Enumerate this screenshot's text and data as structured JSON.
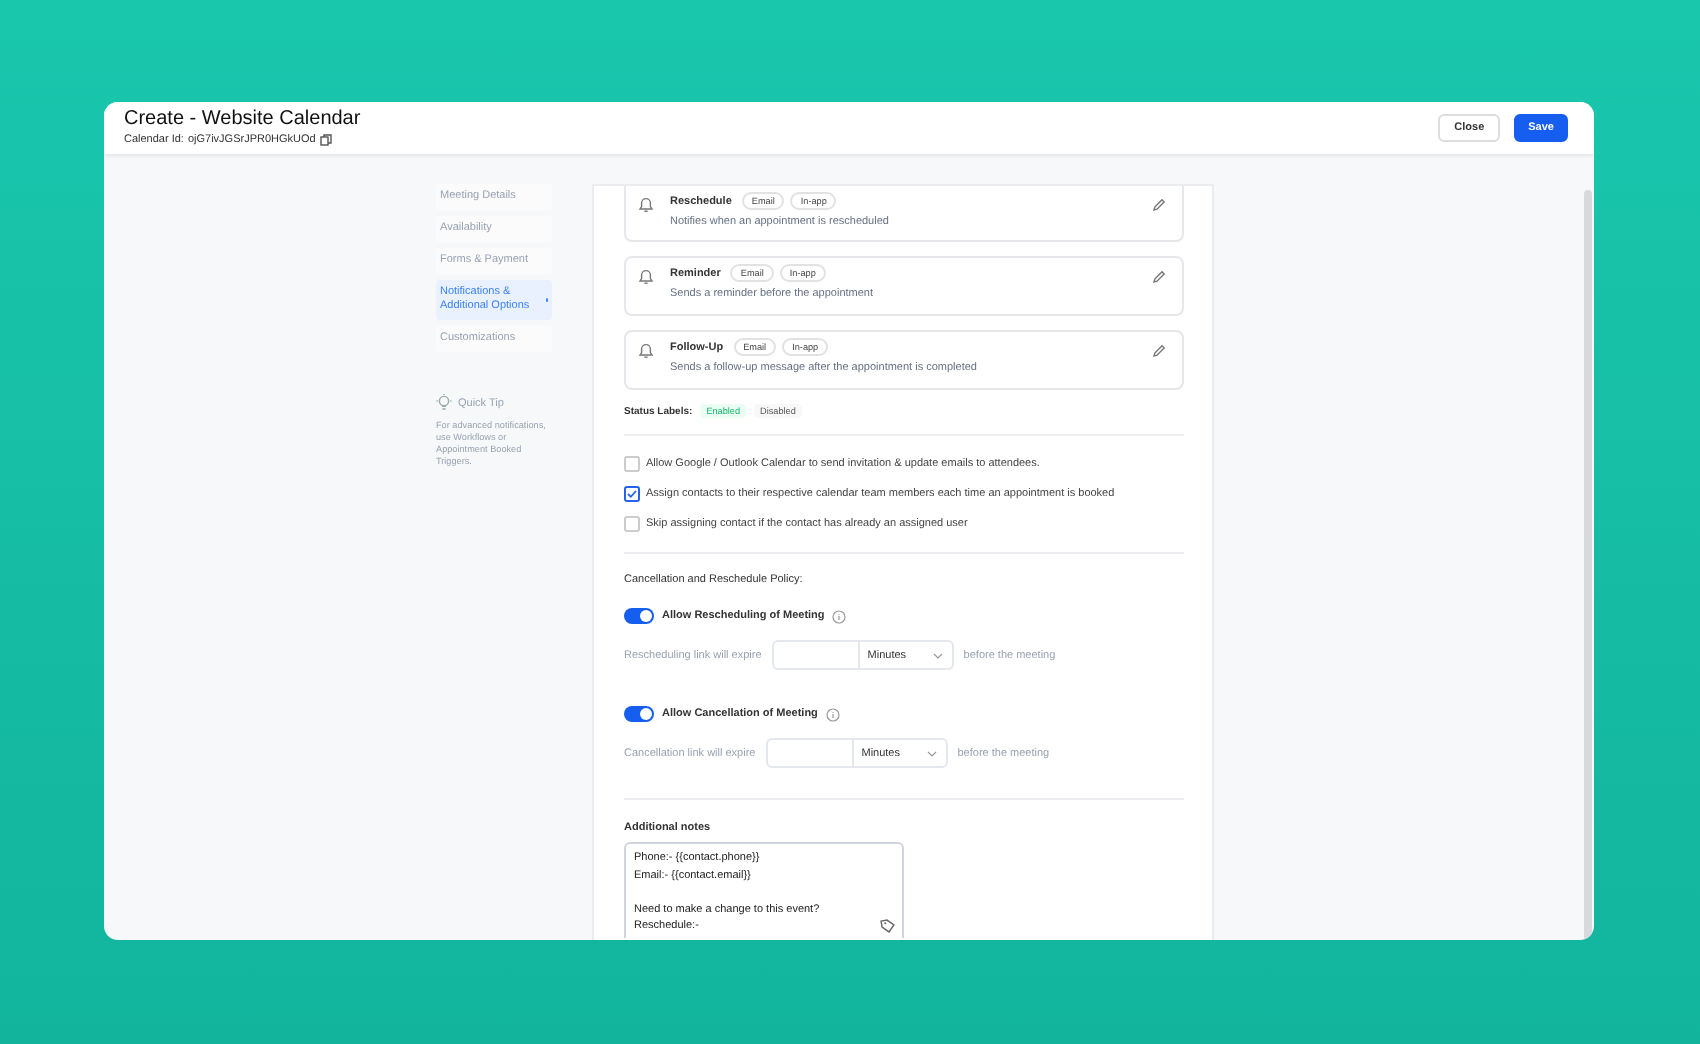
{
  "header": {
    "title": "Create - Website Calendar",
    "id_label": "Calendar Id:",
    "id_value": "ojG7ivJGSrJPR0HGkUOd"
  },
  "buttons": [
    {
      "label": "Close",
      "kind": "secondary"
    },
    {
      "label": "Save",
      "kind": "primary"
    }
  ],
  "sidebar": {
    "items": [
      {
        "label": "Meeting Details",
        "selected": false
      },
      {
        "label": "Availability",
        "selected": false
      },
      {
        "label": "Forms & Payment",
        "selected": false
      },
      {
        "label": "Notifications & Additional Options",
        "selected": true
      },
      {
        "label": "Customizations",
        "selected": false
      }
    ],
    "quick_tip": {
      "title": "Quick Tip",
      "text": "For advanced notifications, use Workflows or Appointment Booked Triggers."
    }
  },
  "notifications": [
    {
      "name": "Reschedule",
      "channels": [
        "Email",
        "In-app"
      ],
      "description": "Notifies when an appointment is rescheduled"
    },
    {
      "name": "Reminder",
      "channels": [
        "Email",
        "In-app"
      ],
      "description": "Sends a reminder before the appointment"
    },
    {
      "name": "Follow-Up",
      "channels": [
        "Email",
        "In-app"
      ],
      "description": "Sends a follow-up message after the appointment is completed"
    }
  ],
  "status_labels": {
    "label": "Status Labels:",
    "items": [
      {
        "text": "Enabled",
        "kind": "enabled"
      },
      {
        "text": "Disabled",
        "kind": "disabled"
      }
    ]
  },
  "options": [
    {
      "label": "Allow Google / Outlook Calendar to send invitation & update emails to attendees.",
      "checked": false
    },
    {
      "label": "Assign contacts to their respective calendar team members each time an appointment is booked",
      "checked": true
    },
    {
      "label": "Skip assigning contact if the contact has already an assigned user",
      "checked": false
    }
  ],
  "policy": {
    "heading": "Cancellation and Reschedule Policy:",
    "rules": [
      {
        "label": "Allow Rescheduling of Meeting",
        "on": true,
        "expire_label": "Rescheduling link will expire",
        "unit": "Minutes",
        "suffix": "before the meeting"
      },
      {
        "label": "Allow Cancellation of Meeting",
        "on": true,
        "expire_label": "Cancellation link will expire",
        "unit": "Minutes",
        "suffix": "before the meeting"
      }
    ]
  },
  "notes": {
    "label": "Additional notes",
    "value": "Phone:- {{contact.phone}}\nEmail:- {{contact.email}}\n\nNeed to make a change to this event?\nReschedule:-"
  }
}
